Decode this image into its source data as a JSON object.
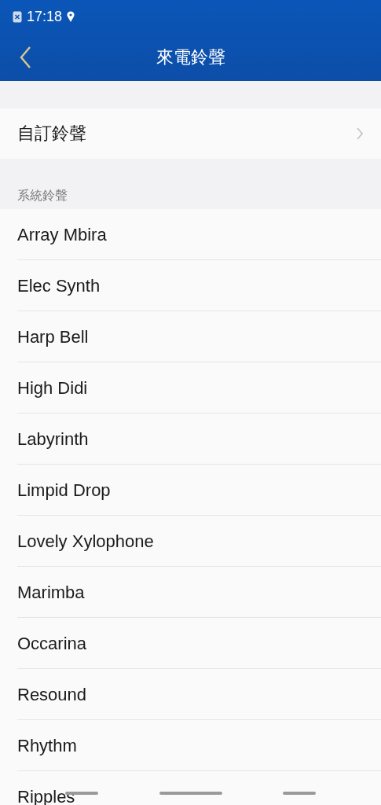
{
  "status_bar": {
    "time": "17:18"
  },
  "header": {
    "title": "來電鈴聲"
  },
  "custom_item": {
    "label": "自訂鈴聲"
  },
  "section": {
    "title": "系統鈴聲"
  },
  "ringtones": [
    {
      "name": "Array Mbira"
    },
    {
      "name": "Elec Synth"
    },
    {
      "name": "Harp Bell"
    },
    {
      "name": "High Didi"
    },
    {
      "name": "Labyrinth"
    },
    {
      "name": "Limpid Drop"
    },
    {
      "name": "Lovely Xylophone"
    },
    {
      "name": "Marimba"
    },
    {
      "name": "Occarina"
    },
    {
      "name": "Resound"
    },
    {
      "name": "Rhythm"
    },
    {
      "name": "Ripples"
    }
  ]
}
